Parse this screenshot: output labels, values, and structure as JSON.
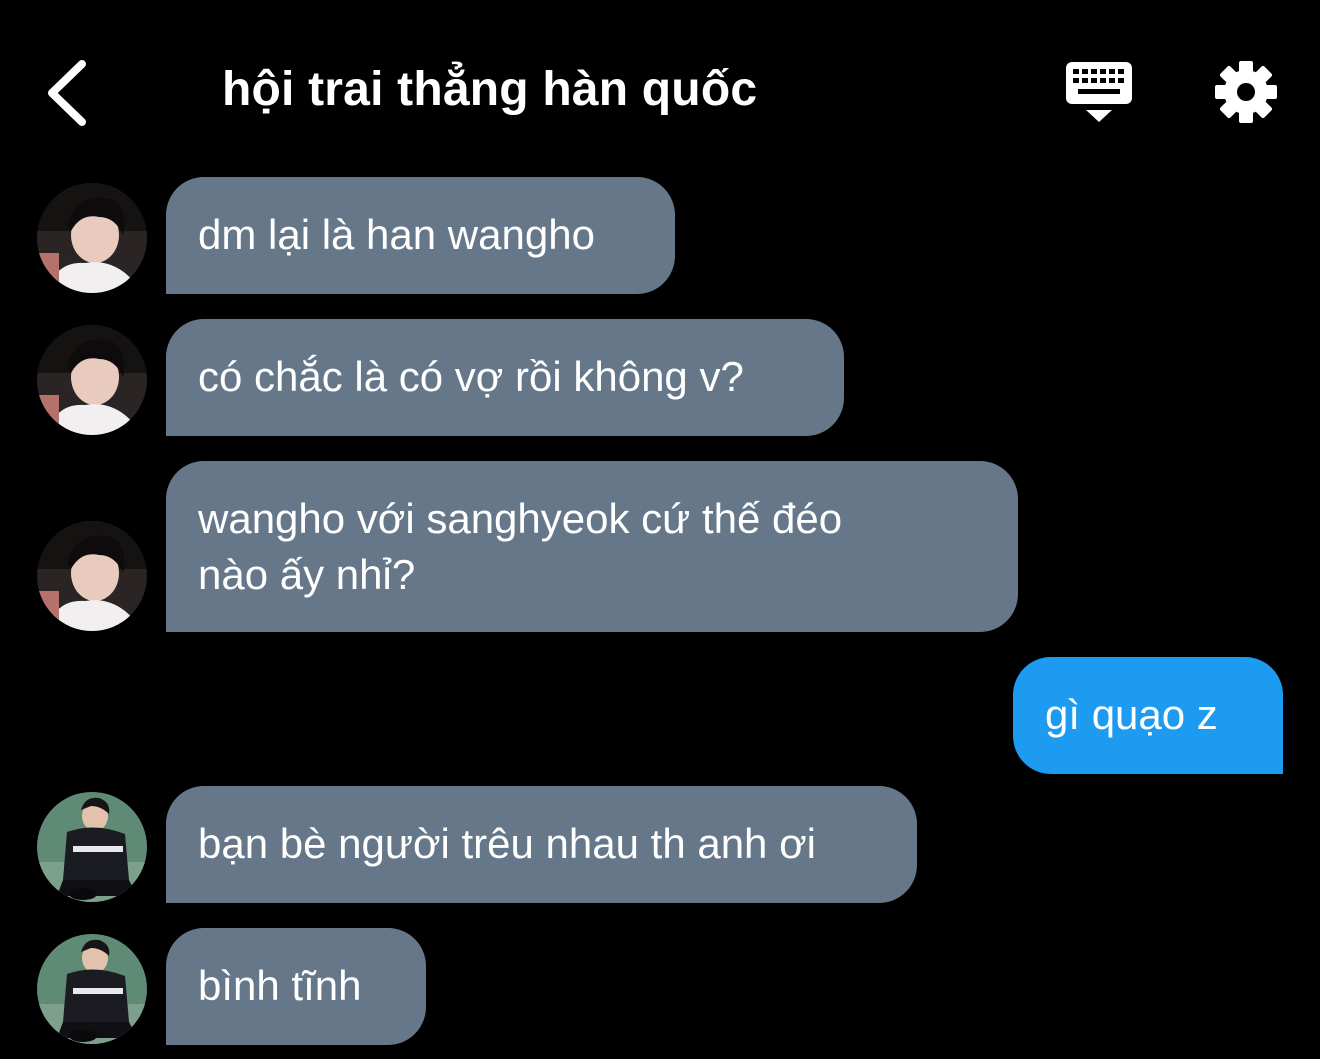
{
  "header": {
    "title": "hội trai thẳng hàn quốc",
    "back_icon": "chevron-left-icon",
    "keyboard_icon": "keyboard-icon",
    "settings_icon": "gear-icon"
  },
  "colors": {
    "background": "#000000",
    "incoming_bubble": "#66778a",
    "outgoing_bubble": "#1d9bf0",
    "text": "#ffffff"
  },
  "messages": [
    {
      "sender": "other",
      "avatar": "avatar-1",
      "text": "dm lại là han wangho"
    },
    {
      "sender": "other",
      "avatar": "avatar-1",
      "text": "có chắc là có vợ rồi không v?"
    },
    {
      "sender": "other",
      "avatar": "avatar-1",
      "text": "wangho với sanghyeok cứ thế đéo\nnào ấy nhỉ?"
    },
    {
      "sender": "me",
      "text": "gì quạo z"
    },
    {
      "sender": "other",
      "avatar": "avatar-2",
      "text": "bạn bè người trêu nhau th anh ơi"
    },
    {
      "sender": "other",
      "avatar": "avatar-2",
      "text": "bình tĩnh"
    }
  ]
}
